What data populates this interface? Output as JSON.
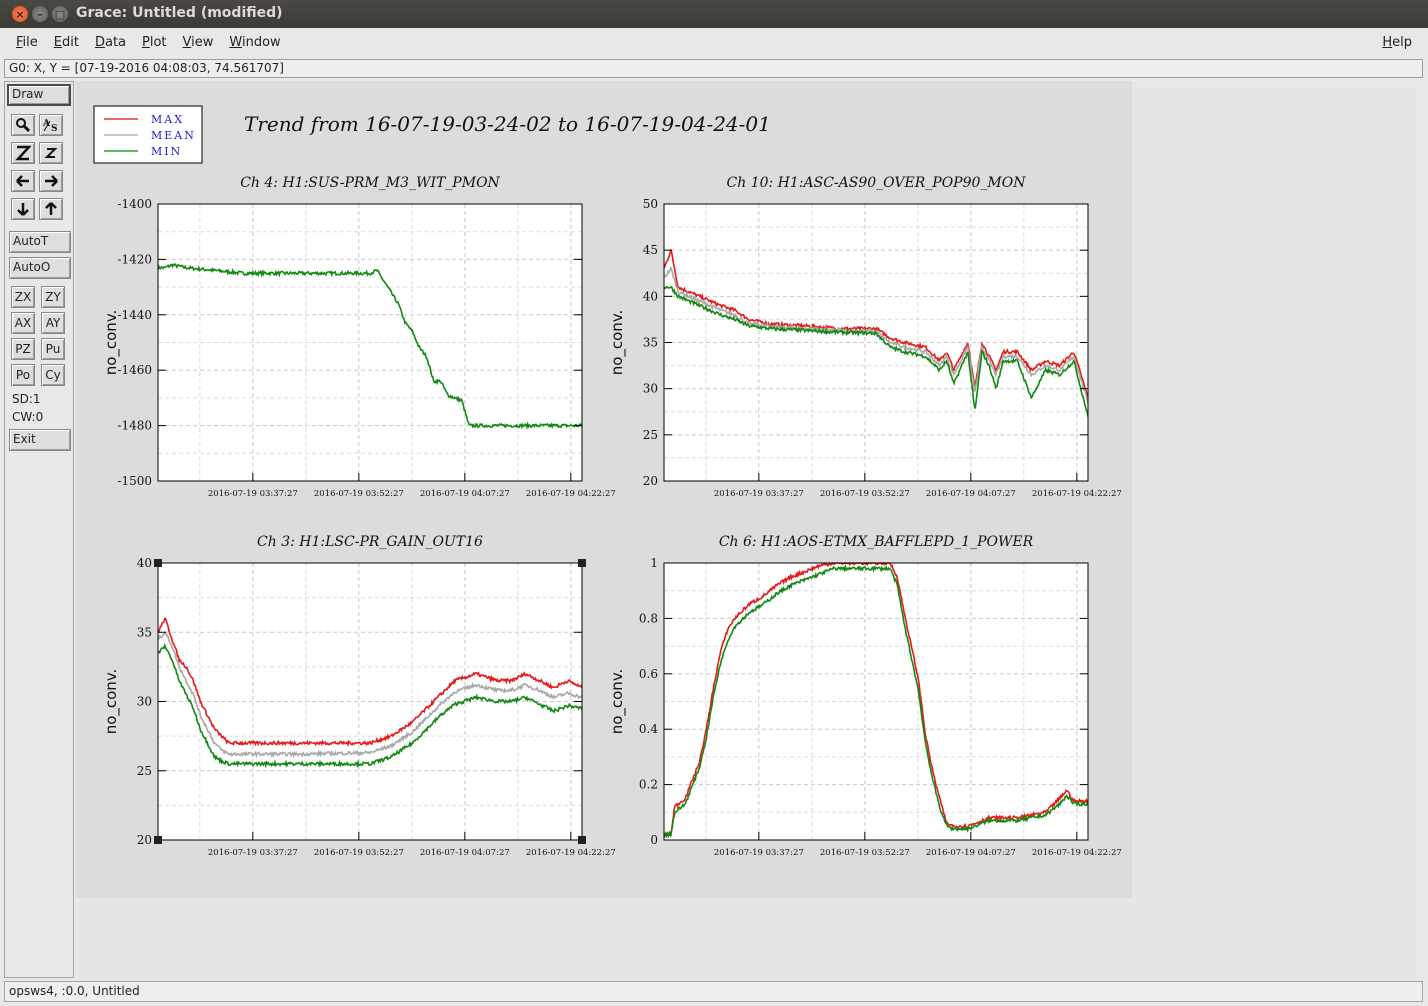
{
  "window": {
    "title": "Grace: Untitled (modified)",
    "close_glyph": "×",
    "minimize_glyph": "–",
    "maximize_glyph": "□"
  },
  "menubar": {
    "items": [
      {
        "underline": "F",
        "rest": "ile"
      },
      {
        "underline": "E",
        "rest": "dit"
      },
      {
        "underline": "D",
        "rest": "ata"
      },
      {
        "underline": "P",
        "rest": "lot"
      },
      {
        "underline": "V",
        "rest": "iew"
      },
      {
        "underline": "W",
        "rest": "indow"
      }
    ],
    "help": {
      "underline": "H",
      "rest": "elp"
    }
  },
  "locator": "G0: X, Y = [07-19-2016 04:08:03, 74.561707]",
  "toolbar": {
    "draw": "Draw",
    "icons": [
      "zoom-icon",
      "autoscale-text-icon",
      "zoom-in-icon",
      "zoom-out-icon",
      "scroll-left-icon",
      "scroll-right-icon",
      "scroll-down-icon",
      "scroll-up-icon"
    ],
    "autot": "AutoT",
    "autoo": "AutoO",
    "small": [
      "ZX",
      "ZY",
      "AX",
      "AY",
      "PZ",
      "Pu",
      "Po",
      "Cy"
    ],
    "sd": "SD:1",
    "cw": "CW:0",
    "exit": "Exit"
  },
  "status": "opsws4, :0.0, Untitled",
  "legend": [
    {
      "label": "MAX",
      "color": "#e01010"
    },
    {
      "label": "MEAN",
      "color": "#a8a8a8"
    },
    {
      "label": "MIN",
      "color": "#0a8a0a"
    }
  ],
  "plot_title": "Trend from 16-07-19-03-24-02 to 16-07-19-04-24-01",
  "colors": {
    "max": "#e41a1a",
    "mean": "#a8a8a8",
    "min": "#118811",
    "legend_text": "#2020d0"
  },
  "chart_data": [
    {
      "type": "line",
      "title": "Ch 4: H1:SUS-PRM_M3_WIT_PMON",
      "ylabel": "no_conv.",
      "ylim": [
        -1500,
        -1400
      ],
      "yticks": [
        "-1400",
        "-1420",
        "-1440",
        "-1460",
        "-1480",
        "-1500"
      ],
      "xlim": [
        0,
        60
      ],
      "xticks": [
        {
          "x": 13.42,
          "label": "2016-07-19 03:37:27"
        },
        {
          "x": 28.42,
          "label": "2016-07-19 03:52:27"
        },
        {
          "x": 43.42,
          "label": "2016-07-19 04:07:27"
        },
        {
          "x": 58.42,
          "label": "2016-07-19 04:22:27"
        }
      ],
      "grid": true,
      "series": [
        {
          "x": [
            0,
            1,
            2,
            4,
            8,
            12,
            16,
            20,
            24,
            28,
            30,
            31,
            33,
            34,
            35,
            36,
            37,
            38,
            39,
            40,
            41,
            42,
            43,
            44,
            45,
            47,
            50,
            55,
            60
          ],
          "values": [
            -1423,
            -1423,
            -1422,
            -1423,
            -1424,
            -1425,
            -1425,
            -1425,
            -1425,
            -1425,
            -1425,
            -1424,
            -1432,
            -1436,
            -1443,
            -1446,
            -1452,
            -1455,
            -1464,
            -1464,
            -1469,
            -1470,
            -1471,
            -1480,
            -1480,
            -1480,
            -1480,
            -1480,
            -1480
          ]
        }
      ]
    },
    {
      "type": "line",
      "title": "Ch 10: H1:ASC-AS90_OVER_POP90_MON",
      "ylabel": "no_conv.",
      "ylim": [
        20,
        50
      ],
      "yticks": [
        "50",
        "45",
        "40",
        "35",
        "30",
        "25",
        "20"
      ],
      "xlim": [
        0,
        60
      ],
      "xticks": [
        {
          "x": 13.42,
          "label": "2016-07-19 03:37:27"
        },
        {
          "x": 28.42,
          "label": "2016-07-19 03:52:27"
        },
        {
          "x": 43.42,
          "label": "2016-07-19 04:07:27"
        },
        {
          "x": 58.42,
          "label": "2016-07-19 04:22:27"
        }
      ],
      "grid": true,
      "series": [
        {
          "name": "MAX",
          "x": [
            0,
            1,
            2,
            5,
            8,
            10,
            12,
            15,
            20,
            25,
            30,
            32,
            34,
            37,
            39,
            40,
            41,
            43,
            44,
            45,
            46,
            47,
            48,
            50,
            52,
            54,
            56,
            58,
            60
          ],
          "values": [
            43,
            45,
            41,
            40,
            39,
            38.5,
            37.5,
            37,
            36.8,
            36.5,
            36.5,
            35.5,
            35,
            34.5,
            33,
            34,
            32,
            35,
            30,
            35,
            33.5,
            32,
            34,
            34,
            32,
            33,
            32.5,
            34,
            29
          ]
        },
        {
          "name": "MEAN",
          "x": [
            0,
            1,
            2,
            5,
            8,
            10,
            12,
            15,
            20,
            25,
            30,
            32,
            34,
            37,
            39,
            40,
            41,
            43,
            44,
            45,
            46,
            47,
            48,
            50,
            52,
            54,
            56,
            58,
            60
          ],
          "values": [
            42,
            43,
            40.5,
            39.5,
            38.5,
            38,
            37,
            36.8,
            36.5,
            36.3,
            36.2,
            35,
            34.5,
            34,
            32.5,
            33.5,
            31.5,
            34.5,
            29.5,
            34.5,
            33,
            31.5,
            33.5,
            33.5,
            31.5,
            32.5,
            32,
            33.5,
            28.5
          ]
        },
        {
          "name": "MIN",
          "x": [
            0,
            1,
            2,
            5,
            8,
            10,
            12,
            15,
            20,
            25,
            30,
            32,
            34,
            37,
            39,
            40,
            41,
            43,
            44,
            45,
            46,
            47,
            48,
            50,
            52,
            54,
            56,
            58,
            60
          ],
          "values": [
            41,
            41,
            40,
            39,
            38,
            37.5,
            36.8,
            36.5,
            36.3,
            36.1,
            36,
            34.5,
            34,
            33.5,
            32,
            33,
            30.5,
            34,
            27.5,
            34,
            32.5,
            30,
            33,
            33,
            29,
            32,
            31.5,
            33,
            27
          ]
        }
      ]
    },
    {
      "type": "line",
      "title": "Ch 3: H1:LSC-PR_GAIN_OUT16",
      "ylabel": "no_conv.",
      "ylim": [
        20,
        40
      ],
      "yticks": [
        "40",
        "35",
        "30",
        "25",
        "20"
      ],
      "xlim": [
        0,
        60
      ],
      "xticks": [
        {
          "x": 13.42,
          "label": "2016-07-19 03:37:27"
        },
        {
          "x": 28.42,
          "label": "2016-07-19 03:52:27"
        },
        {
          "x": 43.42,
          "label": "2016-07-19 04:07:27"
        },
        {
          "x": 58.42,
          "label": "2016-07-19 04:22:27"
        }
      ],
      "grid": true,
      "series": [
        {
          "name": "MAX",
          "x": [
            0,
            1,
            2,
            3,
            4,
            5,
            6,
            7,
            8,
            9,
            10,
            20,
            30,
            33,
            36,
            38,
            40,
            42,
            45,
            48,
            50,
            52,
            54,
            56,
            58,
            60
          ],
          "values": [
            35,
            36,
            34.5,
            33,
            32.5,
            31.5,
            30,
            29,
            28,
            27.5,
            27,
            27,
            27,
            27.5,
            28.5,
            29.5,
            30.5,
            31.5,
            32,
            31.5,
            31.5,
            32,
            31.5,
            31,
            31.5,
            31
          ]
        },
        {
          "name": "MEAN",
          "x": [
            0,
            1,
            2,
            3,
            4,
            5,
            6,
            7,
            8,
            9,
            10,
            20,
            30,
            33,
            36,
            38,
            40,
            42,
            45,
            48,
            50,
            52,
            54,
            56,
            58,
            60
          ],
          "values": [
            34.5,
            35,
            34,
            32.5,
            31.5,
            30.5,
            29,
            28,
            27,
            26.5,
            26.2,
            26.2,
            26.3,
            26.8,
            27.8,
            28.8,
            29.8,
            30.7,
            31.2,
            30.8,
            30.8,
            31.2,
            30.8,
            30.3,
            30.6,
            30.3
          ]
        },
        {
          "name": "MIN",
          "x": [
            0,
            1,
            2,
            3,
            4,
            5,
            6,
            7,
            8,
            9,
            10,
            20,
            30,
            33,
            36,
            38,
            40,
            42,
            45,
            48,
            50,
            52,
            54,
            56,
            58,
            60
          ],
          "values": [
            33.5,
            34,
            33,
            31.5,
            30.5,
            29.5,
            28,
            27,
            26,
            25.7,
            25.5,
            25.5,
            25.5,
            26,
            27,
            28,
            29,
            29.8,
            30.3,
            30,
            30,
            30.3,
            29.8,
            29.3,
            29.7,
            29.5
          ]
        }
      ]
    },
    {
      "type": "line",
      "title": "Ch 6: H1:AOS-ETMX_BAFFLEPD_1_POWER",
      "ylabel": "no_conv.",
      "ylim": [
        0,
        1
      ],
      "yticks": [
        "1",
        "0.8",
        "0.6",
        "0.4",
        "0.2",
        "0"
      ],
      "xlim": [
        0,
        60
      ],
      "xticks": [
        {
          "x": 13.42,
          "label": "2016-07-19 03:37:27"
        },
        {
          "x": 28.42,
          "label": "2016-07-19 03:52:27"
        },
        {
          "x": 43.42,
          "label": "2016-07-19 04:07:27"
        },
        {
          "x": 58.42,
          "label": "2016-07-19 04:22:27"
        }
      ],
      "grid": true,
      "series": [
        {
          "name": "MAX",
          "x": [
            0,
            1,
            1.5,
            3,
            5,
            6,
            7,
            8,
            9,
            10,
            12,
            14,
            16,
            18,
            20,
            22,
            24,
            26,
            28,
            30,
            32,
            33,
            34,
            35,
            36,
            37,
            38,
            39,
            40,
            41,
            42,
            43,
            44,
            46,
            48,
            50,
            52,
            54,
            56,
            57,
            58,
            60
          ],
          "values": [
            0.02,
            0.02,
            0.12,
            0.15,
            0.28,
            0.4,
            0.55,
            0.68,
            0.76,
            0.8,
            0.85,
            0.88,
            0.92,
            0.95,
            0.97,
            0.99,
            1,
            1,
            1,
            1,
            1,
            0.95,
            0.82,
            0.7,
            0.58,
            0.38,
            0.25,
            0.15,
            0.06,
            0.05,
            0.05,
            0.05,
            0.06,
            0.08,
            0.08,
            0.08,
            0.09,
            0.1,
            0.15,
            0.18,
            0.14,
            0.14
          ]
        },
        {
          "name": "MIN",
          "x": [
            0,
            1,
            1.5,
            3,
            5,
            6,
            7,
            8,
            9,
            10,
            12,
            14,
            16,
            18,
            20,
            22,
            24,
            26,
            28,
            30,
            32,
            33,
            34,
            35,
            36,
            37,
            38,
            39,
            40,
            41,
            42,
            43,
            44,
            46,
            48,
            50,
            52,
            54,
            56,
            57,
            58,
            60
          ],
          "values": [
            0.02,
            0.02,
            0.1,
            0.13,
            0.26,
            0.37,
            0.52,
            0.64,
            0.72,
            0.77,
            0.82,
            0.85,
            0.89,
            0.92,
            0.94,
            0.96,
            0.98,
            0.98,
            0.98,
            0.98,
            0.98,
            0.92,
            0.78,
            0.66,
            0.54,
            0.35,
            0.22,
            0.12,
            0.05,
            0.04,
            0.04,
            0.04,
            0.05,
            0.07,
            0.07,
            0.07,
            0.08,
            0.09,
            0.13,
            0.16,
            0.13,
            0.13
          ]
        }
      ]
    }
  ]
}
